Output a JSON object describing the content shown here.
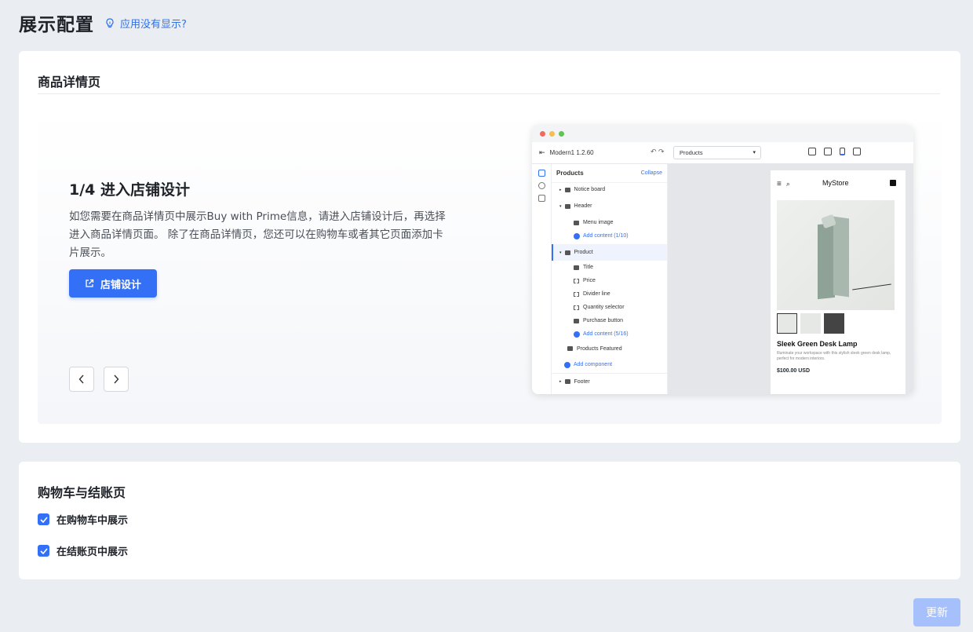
{
  "header": {
    "title": "展示配置",
    "help_link": "应用没有显示?"
  },
  "product_section": {
    "title": "商品详情页",
    "step_title": "1/4 进入店铺设计",
    "step_desc": "如您需要在商品详情页中展示Buy with Prime信息，请进入店铺设计后，再选择进入商品详情页面。 除了在商品详情页，您还可以在购物车或者其它页面添加卡片展示。",
    "design_button": "店铺设计",
    "prev_icon": "chevron-left-icon",
    "next_icon": "chevron-right-icon"
  },
  "preview": {
    "window_dots": [
      "#f26a5f",
      "#f6bd4f",
      "#5fc454"
    ],
    "app_version": "Modern1  1.2.60",
    "page_select": "Products",
    "tree_title": "Products",
    "collapse": "Collapse",
    "tree": [
      {
        "label": "Notice board",
        "kind": "section"
      },
      {
        "label": "Header",
        "kind": "section"
      },
      {
        "label": "Menu image",
        "kind": "child"
      },
      {
        "label": "Add content (1/10)",
        "kind": "add"
      },
      {
        "label": "Product",
        "kind": "active"
      },
      {
        "label": "Title",
        "kind": "child"
      },
      {
        "label": "Price",
        "kind": "child"
      },
      {
        "label": "Divider line",
        "kind": "child"
      },
      {
        "label": "Quantity selector",
        "kind": "child"
      },
      {
        "label": "Purchase button",
        "kind": "child"
      },
      {
        "label": "Add content (5/16)",
        "kind": "add"
      },
      {
        "label": "Products Featured",
        "kind": "section2"
      },
      {
        "label": "Add component",
        "kind": "add2"
      },
      {
        "label": "Footer",
        "kind": "section"
      }
    ],
    "store_name": "MyStore",
    "product_name": "Sleek Green Desk Lamp",
    "product_desc": "Illuminate your workspace with this stylish sleek green desk lamp, perfect for modern interiors.",
    "product_price": "$100.00 USD"
  },
  "cart_section": {
    "title": "购物车与结账页",
    "options": [
      {
        "label": "在购物车中展示",
        "checked": true
      },
      {
        "label": "在结账页中展示",
        "checked": true
      }
    ]
  },
  "footer": {
    "update_button": "更新"
  },
  "colors": {
    "primary": "#3370f5",
    "primary_disabled": "#a6c0fb",
    "link": "#3070e8",
    "background": "#eaedf1"
  }
}
